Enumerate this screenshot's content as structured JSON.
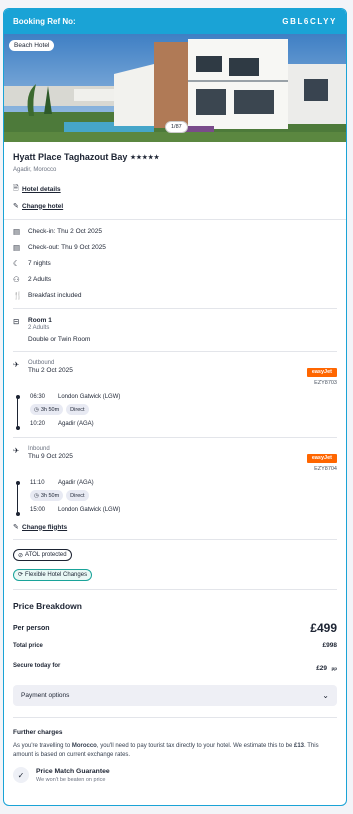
{
  "booking": {
    "ref_label": "Booking Ref No:",
    "ref_code": "GBL6CLYY"
  },
  "hero": {
    "tag": "Beach Hotel",
    "counter": "1/87"
  },
  "hotel": {
    "name": "Hyatt Place Taghazout Bay",
    "stars": "★★★★★",
    "location": "Agadir, Morocco",
    "details_link": "Hotel details",
    "change_link": "Change hotel"
  },
  "stay": {
    "checkin": "Check-in: Thu 2 Oct 2025",
    "checkout": "Check-out: Thu 9 Oct 2025",
    "nights": "7 nights",
    "guests": "2 Adults",
    "board": "Breakfast included"
  },
  "room": {
    "title": "Room 1",
    "guests": "2 Adults",
    "type": "Double or Twin Room"
  },
  "flights": [
    {
      "direction": "Outbound",
      "date": "Thu 2 Oct 2025",
      "airline": "easyJet",
      "code": "EZY8703",
      "dep_time": "06:30",
      "dep_place": "London Gatwick (LGW)",
      "duration": "3h 50m",
      "stops": "Direct",
      "arr_time": "10:20",
      "arr_place": "Agadir (AGA)"
    },
    {
      "direction": "Inbound",
      "date": "Thu 9 Oct 2025",
      "airline": "easyJet",
      "code": "EZY8704",
      "dep_time": "11:10",
      "dep_place": "Agadir (AGA)",
      "duration": "3h 50m",
      "stops": "Direct",
      "arr_time": "15:00",
      "arr_place": "London Gatwick (LGW)"
    }
  ],
  "change_flights": "Change flights",
  "badges": {
    "atol": "ATOL protected",
    "flex": "Flexible Hotel Changes"
  },
  "price": {
    "title": "Price Breakdown",
    "per_person_label": "Per person",
    "per_person_value": "£499",
    "total_label": "Total price",
    "total_value": "£998",
    "secure_label": "Secure today for",
    "secure_value": "£29",
    "secure_suffix": "pp",
    "payment_options": "Payment options"
  },
  "further": {
    "title": "Further charges",
    "text_1": "As you're travelling to ",
    "destination": "Morocco",
    "text_2": ", you'll need to pay tourist tax directly to your hotel. We estimate this to be ",
    "amount": "£13",
    "text_3": ". This amount is based on current exchange rates."
  },
  "price_match": {
    "title": "Price Match Guarantee",
    "subtitle": "We won't be beaten on price"
  },
  "colors": {
    "accent": "#1aa3d6",
    "easyjet": "#ff6600",
    "flex": "#1aa39a"
  }
}
